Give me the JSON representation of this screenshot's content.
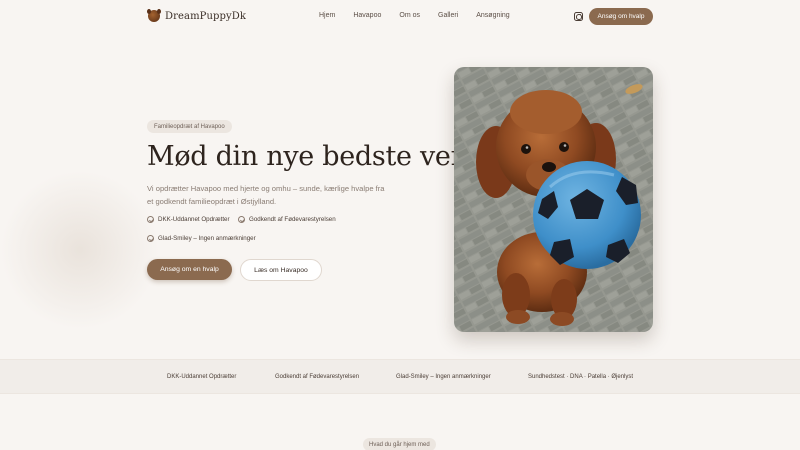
{
  "brand": {
    "name": "DreamPuppyDk"
  },
  "nav": {
    "links": [
      "Hjem",
      "Havapoo",
      "Om os",
      "Galleri",
      "Ansøgning"
    ],
    "cta": "Ansøg om hvalp",
    "social_icon": "instagram-icon"
  },
  "hero": {
    "badge": "Familieopdræt af Havapoo",
    "title": "Mød din nye bedste ven",
    "subtitle": "Vi opdrætter Havapoo med hjerte og omhu – sunde, kærlige hvalpe fra et godkendt familieopdræt i Østjylland.",
    "checks": [
      "DKK-Uddannet Opdrætter",
      "Godkendt af Fødevarestyrelsen",
      "Glad-Smiley – Ingen anmærkninger"
    ],
    "primary_button": "Ansøg om en hvalp",
    "secondary_button": "Læs om Havapoo",
    "image": "brown-puppy-with-blue-ball"
  },
  "trust_strip": {
    "items": [
      "DKK-Uddannet Opdrætter",
      "Godkendt af Fødevarestyrelsen",
      "Glad-Smiley – Ingen anmærkninger",
      "Sundhedstest · DNA · Patella · Øjenlyst"
    ]
  },
  "next_section": {
    "label": "Hvad du går hjem med"
  },
  "colors": {
    "accent": "#8b6a4f",
    "background": "#f8f5f2",
    "text": "#2e241e",
    "muted": "#8a7d74"
  }
}
